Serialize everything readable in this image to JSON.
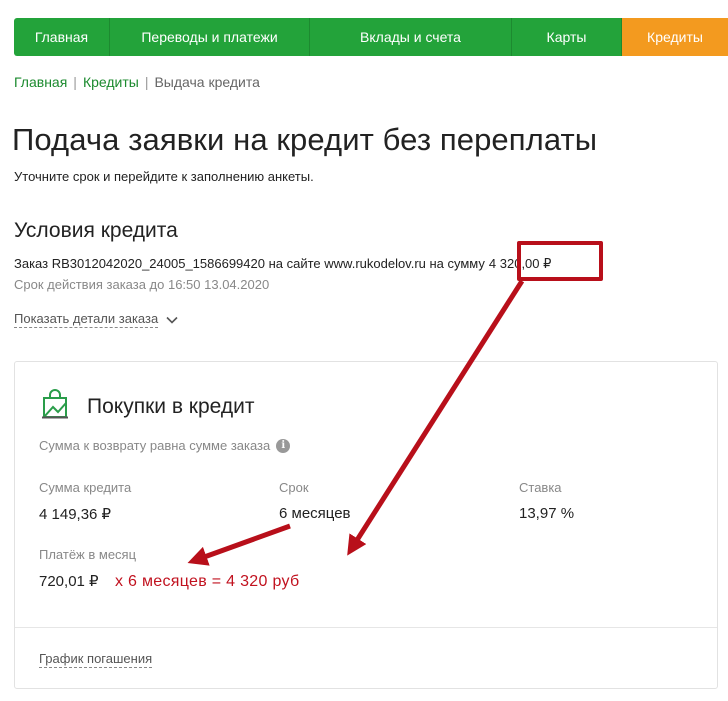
{
  "nav": {
    "items": [
      {
        "label": "Главная"
      },
      {
        "label": "Переводы и платежи"
      },
      {
        "label": "Вклады и счета"
      },
      {
        "label": "Карты"
      },
      {
        "label": "Кредиты"
      }
    ],
    "active_index": 4,
    "colors": {
      "green": "#23a33a",
      "orange": "#f39a1f"
    }
  },
  "breadcrumb": {
    "items": [
      "Главная",
      "Кредиты"
    ],
    "separator": "|",
    "current": "Выдача кредита"
  },
  "page": {
    "title": "Подача заявки на кредит без переплаты",
    "subtitle": "Уточните срок и перейдите к заполнению анкеты."
  },
  "conditions": {
    "title": "Условия кредита",
    "order_text": "Заказ RB3012042020_24005_1586699420 на сайте www.rukodelov.ru на сумму",
    "order_sum": "4 320,00 ₽",
    "expiry": "Срок действия заказа до 16:50 13.04.2020",
    "details_link": "Показать детали заказа"
  },
  "card": {
    "icon": "shopping-bag-icon",
    "title": "Покупки в кредит",
    "note": "Сумма к возврату равна сумме заказа",
    "info_icon_glyph": "i",
    "fields": {
      "credit_sum": {
        "label": "Сумма кредита",
        "value": "4 149,36 ₽"
      },
      "term": {
        "label": "Срок",
        "value": "6 месяцев"
      },
      "rate": {
        "label": "Ставка",
        "value": "13,97 %"
      },
      "monthly": {
        "label": "Платёж в месяц",
        "value": "720,01 ₽"
      }
    },
    "annotation": "х 6 месяцев = 4 320 руб",
    "schedule_link": "График погашения"
  },
  "colors": {
    "link_green": "#1b8a2e",
    "annotation_red": "#c1121f",
    "highlight_red": "#b80f1a"
  }
}
